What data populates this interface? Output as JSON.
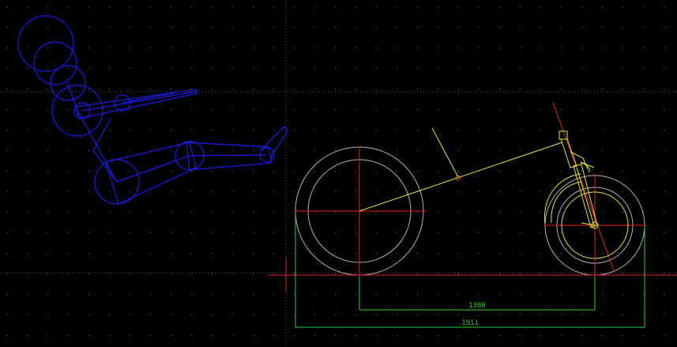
{
  "drawing": {
    "background": "#000000",
    "colors": {
      "grid_dots": "#6e6e6e",
      "guide_dots": "#5a5a5a",
      "rider": "#1c1ce6",
      "frame": "#e6e62a",
      "fork_center": "#e62222",
      "wheel_circles": "#b4b4b4",
      "dimension": "#33cc33"
    },
    "dimensions": {
      "wheelbase_label": "1380",
      "overall_length_label": "1911"
    }
  }
}
